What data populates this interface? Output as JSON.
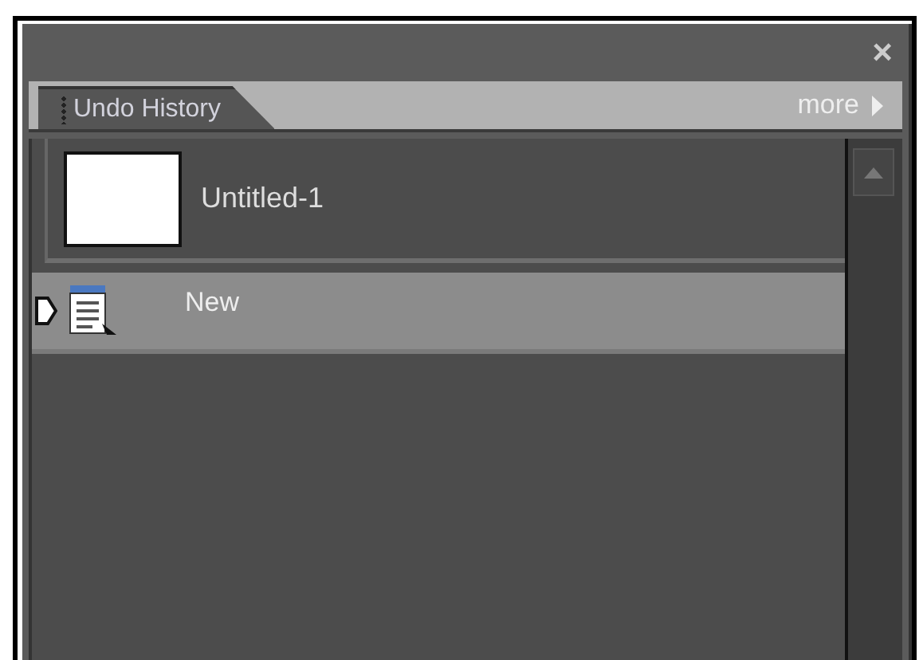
{
  "panel": {
    "close": "×"
  },
  "tab": {
    "label": "Undo History",
    "selected": true
  },
  "menu": {
    "label": "more"
  },
  "snapshot": {
    "label": "Untitled-1"
  },
  "history": [
    {
      "label": "New",
      "selected": true
    }
  ]
}
